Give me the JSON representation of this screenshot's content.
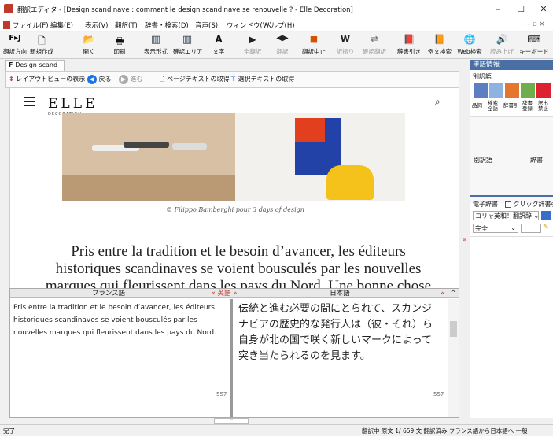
{
  "window": {
    "title": "翻訳エディタ - [Design scandinave : comment le design scandinave se renouvelle ? - Elle Decoration]"
  },
  "menu": [
    "ファイル(F)",
    "編集(E)",
    "表示(V)",
    "翻訳(T)",
    "辞書・検索(D)",
    "音声(S)",
    "ウィンドウ(W)",
    "ヘルプ(H)"
  ],
  "toolbar": {
    "items": [
      {
        "label": "翻訳方向",
        "glyph": "F▸J"
      },
      {
        "label": "新規作成",
        "glyph": "🗋"
      },
      {
        "label": "開く",
        "glyph": "📂"
      },
      {
        "label": "印刷",
        "glyph": "🖶"
      },
      {
        "label": "表示形式",
        "glyph": "▥"
      },
      {
        "label": "確認エリア",
        "glyph": "▥"
      },
      {
        "label": "文字",
        "glyph": "A"
      },
      {
        "label": "全翻訳",
        "glyph": "▶"
      },
      {
        "label": "翻訳",
        "glyph": "◀▶"
      },
      {
        "label": "翻訳中止",
        "glyph": "■"
      },
      {
        "label": "訳振り",
        "glyph": "W"
      },
      {
        "label": "確認翻訳",
        "glyph": "⇄"
      },
      {
        "label": "辞書引き",
        "glyph": "📕"
      },
      {
        "label": "例文検索",
        "glyph": "📙"
      },
      {
        "label": "Web検索",
        "glyph": "🌐"
      },
      {
        "label": "読み上げ",
        "glyph": "🔊"
      },
      {
        "label": "キーボード",
        "glyph": "⌨"
      }
    ]
  },
  "doc_tab": "Design scand",
  "browse": {
    "layout_view": "レイアウトビューの表示",
    "back": "戻る",
    "forward": "進む",
    "get_page_text": "ページテキストの取得",
    "get_selected_text": "選択テキストの取得"
  },
  "web": {
    "logo": "ELLE",
    "logo_sub": "DECORATION",
    "caption": "© Filippo Bamberghi pour 3 days of design",
    "headline": "Pris entre la tradition et le besoin d’avancer, les éditeurs historiques scandinaves se voient bousculés par les nouvelles marques qui fleurissent dans les pays du Nord. Une bonne chose"
  },
  "panes": {
    "source_header": "フランス語",
    "arrow": "« 英語 »",
    "target_header": "日本語",
    "source_text": "Pris entre la tradition et le besoin d’avancer, les éditeurs historiques scandinaves se voient bousculés par les nouvelles marques qui fleurissent dans les pays du Nord.",
    "target_text": "伝統と進む必要の間にとられて、スカンジナビアの歴史的な発行人は（彼・それ）ら自身が北の国で咲く新しいマークによって突き当たられるのを見ます。",
    "source_count": "557",
    "target_count": "557"
  },
  "right_panel": {
    "title": "単語情報",
    "tab": "別訳語",
    "buttons": [
      "品詞",
      "検索 全語",
      "辞書引",
      "辞書 登録",
      "訳出 禁止"
    ],
    "alt_label": "別訳語",
    "dict_label": "辞書",
    "edict_label": "電子辞書",
    "click_dict": "クリック辞書引",
    "dict_select": "コリャ英和！翻訳辞",
    "match_select": "完全"
  },
  "status": {
    "left": "完了",
    "right": "翻訳中  原文  1/ 659 文  翻訳済み  フランス語から日本語へ  一般"
  },
  "colors": {
    "accent": "#4a6fa5",
    "titleicon": "#c0392b"
  }
}
